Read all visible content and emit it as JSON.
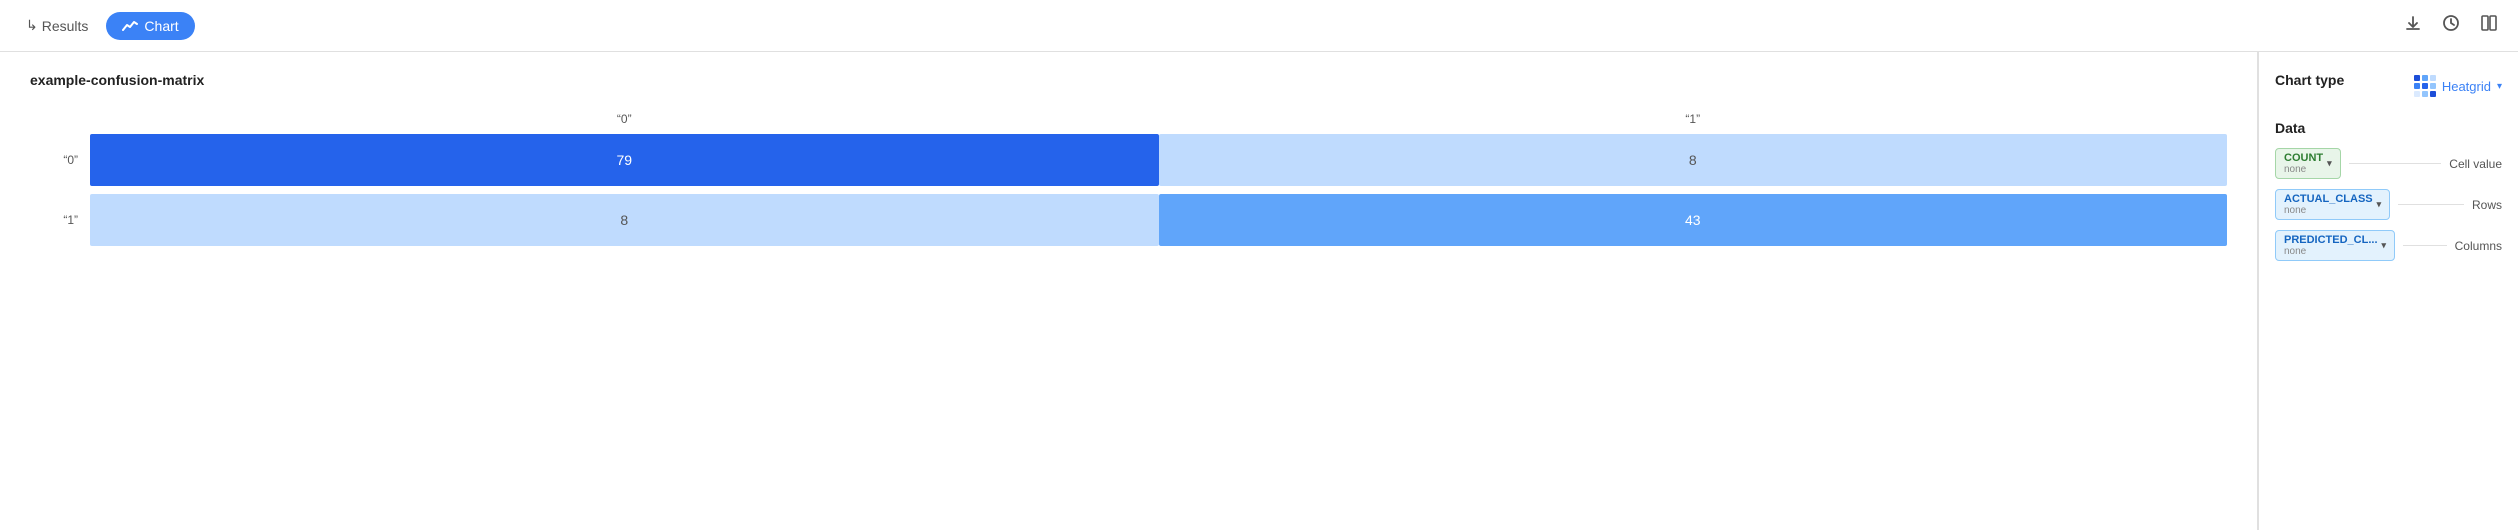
{
  "topbar": {
    "results_label": "Results",
    "chart_label": "Chart",
    "results_arrow": "↳",
    "chart_icon": "〜"
  },
  "chart": {
    "title": "example-confusion-matrix",
    "col_headers": [
      "\"0\"",
      "\"1\""
    ],
    "rows": [
      {
        "label": "\"0\"",
        "cells": [
          {
            "value": "79",
            "type": "dark"
          },
          {
            "value": "8",
            "type": "light"
          }
        ]
      },
      {
        "label": "\"1\"",
        "cells": [
          {
            "value": "8",
            "type": "light"
          },
          {
            "value": "43",
            "type": "medium"
          }
        ]
      }
    ]
  },
  "right_panel": {
    "chart_type_label": "Chart type",
    "heatgrid_label": "Heatgrid",
    "data_label": "Data",
    "count_badge_main": "COUNT",
    "count_badge_sub": "none",
    "actual_class_badge_main": "ACTUAL_CLASS",
    "actual_class_badge_sub": "none",
    "predicted_badge_main": "PREDICTED_CL...",
    "predicted_badge_sub": "none",
    "cell_value_label": "Cell value",
    "rows_label": "Rows",
    "columns_label": "Columns",
    "heatgrid_colors": [
      "#2563eb",
      "#3b82f6",
      "#bfdbfe",
      "#93c5fd",
      "#dbeafe",
      "#eff6ff",
      "#1d4ed8",
      "#60a5fa",
      "#93c5fd"
    ]
  }
}
